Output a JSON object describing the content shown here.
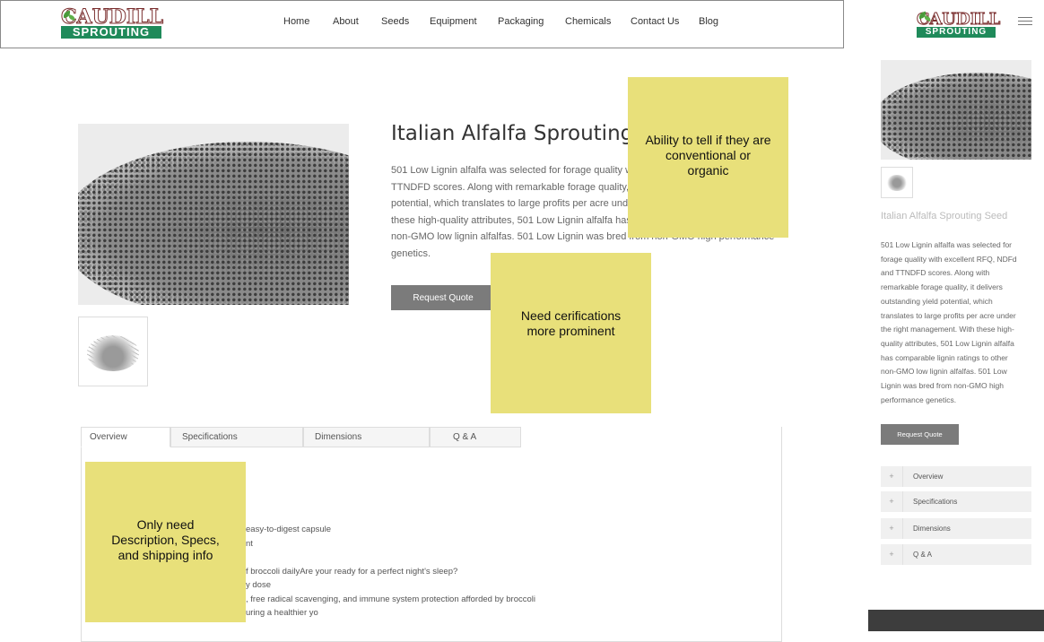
{
  "brand": {
    "name_top": "CAUDILL",
    "name_bottom": "SPROUTING"
  },
  "nav": {
    "items": [
      "Home",
      "About",
      "Seeds",
      "Equipment",
      "Packaging",
      "Chemicals",
      "Contact Us",
      "Blog"
    ]
  },
  "product": {
    "title": "Italian Alfalfa Sprouting Seeds",
    "description_lines": [
      "501 Low Lignin alfalfa was selected for forage quality with excellent RFQ, NDFd and",
      "TTNDFD scores.  Along with remarkable forage quality, it delivers outstanding yield",
      "potential, which translates to large profits per acre under the right management. With",
      "these high-quality attributes, 501 Low Lignin alfalfa has comparable lignin ratings to other",
      "non-GMO low lignin alfalfas. 501 Low Lignin was bred from non-GMO high performance",
      "genetics."
    ],
    "quote_button": "Request Quote"
  },
  "tabs": [
    "Overview",
    "Specifications",
    "Dimensions",
    "Q & A"
  ],
  "overview_lines": [
    "easy-to-digest capsule",
    "nt",
    "",
    "f broccoli dailyAre your ready for a perfect night's sleep?",
    "y dose",
    ", free radical scavenging, and immune system protection afforded by broccoli",
    "uring a healthier yo"
  ],
  "mobile": {
    "title": "Italian Alfalfa Sprouting Seed",
    "description_lines": [
      "501 Low Lignin alfalfa was selected for",
      "forage quality with excellent RFQ, NDFd",
      "and TTNDFD scores.  Along with",
      "remarkable forage quality, it delivers",
      "outstanding yield potential, which",
      "translates to large profits per acre under",
      "the right management. With these high-",
      "quality attributes, 501 Low Lignin alfalfa",
      "has comparable lignin ratings to other",
      "non-GMO low lignin alfalfas. 501 Low",
      "Lignin was bred from non-GMO high",
      "performance genetics."
    ],
    "quote_button": "Request Quote",
    "accordion": [
      {
        "label": "Overview",
        "icon": "+"
      },
      {
        "label": "Specifications",
        "icon": "+"
      },
      {
        "label": "Dimensions",
        "icon": "+"
      },
      {
        "label": "Q & A",
        "icon": "+"
      }
    ]
  },
  "notes": [
    {
      "lines": [
        "Ability to tell if they are",
        "conventional or",
        "organic"
      ]
    },
    {
      "lines": [
        "Need cerifications",
        "more prominent"
      ]
    },
    {
      "lines": [
        "Only need",
        "Description, Specs,",
        "and shipping info"
      ]
    }
  ],
  "colors": {
    "note": "#e8e07a",
    "button": "#7b7b7b",
    "brand_green": "#1f8a5a",
    "brand_red": "#7a2e2e"
  }
}
